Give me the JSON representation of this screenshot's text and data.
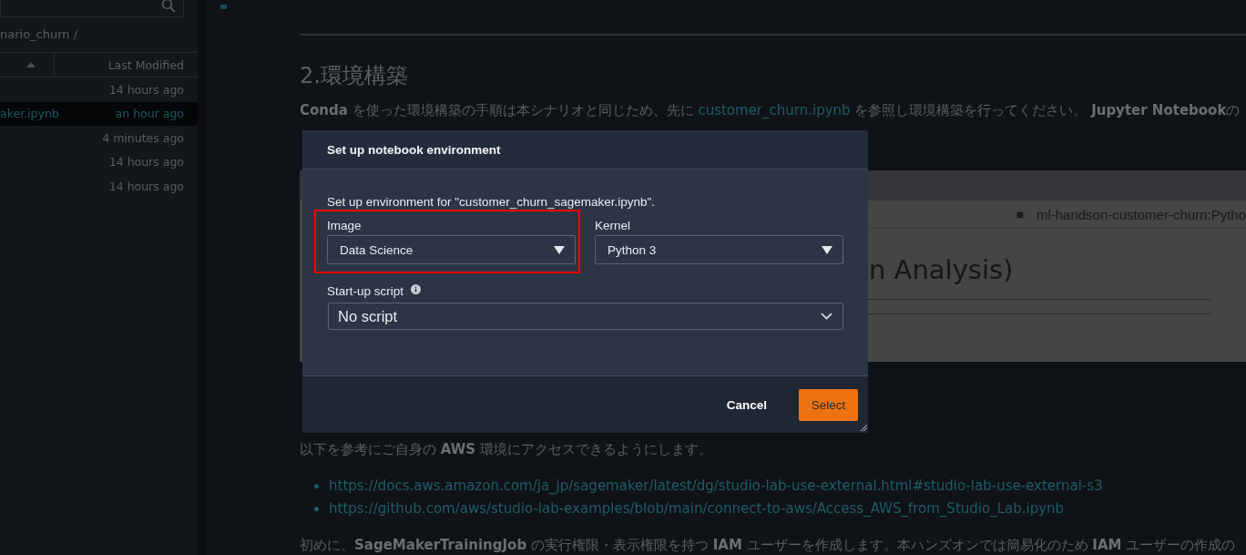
{
  "sidebar": {
    "breadcrumb": "nario_churn /",
    "columns": [
      {
        "sorted": true
      },
      {
        "label": "Last Modified",
        "sorted": false
      }
    ],
    "rows": [
      {
        "modified": "14 hours ago",
        "selected": false
      },
      {
        "name": "aker.ipynb",
        "modified": "an hour ago",
        "selected": true
      },
      {
        "modified": "4 minutes ago",
        "selected": false
      },
      {
        "modified": "14 hours ago",
        "selected": false
      },
      {
        "modified": "14 hours ago",
        "selected": false
      }
    ]
  },
  "notebook": {
    "heading": "2.環境構築",
    "intro": [
      {
        "kind": "text",
        "text": "**Conda** を使った環境構築の手順は本シナリオと同じため、先に "
      },
      {
        "kind": "link",
        "text": "customer_churn.ipynb"
      },
      {
        "kind": "text",
        "text": " を参照し環境構築を行ってください。 **Jupyter Notebook**の"
      }
    ],
    "embed": {
      "kernel": "ml-handson-customer-churn:Pytho",
      "title": "n Analysis)"
    },
    "access_text": "以下を参考にご自身の **AWS** 環境にアクセスできるようにします。",
    "links": [
      "https://docs.aws.amazon.com/ja_jp/sagemaker/latest/dg/studio-lab-use-external.html#studio-lab-use-external-s3",
      "https://github.com/aws/studio-lab-examples/blob/main/connect-to-aws/Access_AWS_from_Studio_Lab.ipynb"
    ],
    "iam_text": "初めに、**SageMakerTrainingJob** の実行権限・表示権限を持つ **IAM** ユーザーを作成します。本ハンズオンでは簡易化のため **IAM** ユーザーの作成の"
  },
  "dialog": {
    "title": "Set up notebook environment",
    "description": "Set up environment for \"customer_churn_sagemaker.ipynb\".",
    "image": {
      "label": "Image",
      "value": "Data Science",
      "highlighted": true
    },
    "kernel": {
      "label": "Kernel",
      "value": "Python 3",
      "highlighted": false
    },
    "startup": {
      "label": "Start-up script",
      "value": "No script"
    },
    "buttons": [
      {
        "label": "Cancel",
        "kind": "secondary"
      },
      {
        "label": "Select",
        "kind": "primary"
      }
    ]
  }
}
